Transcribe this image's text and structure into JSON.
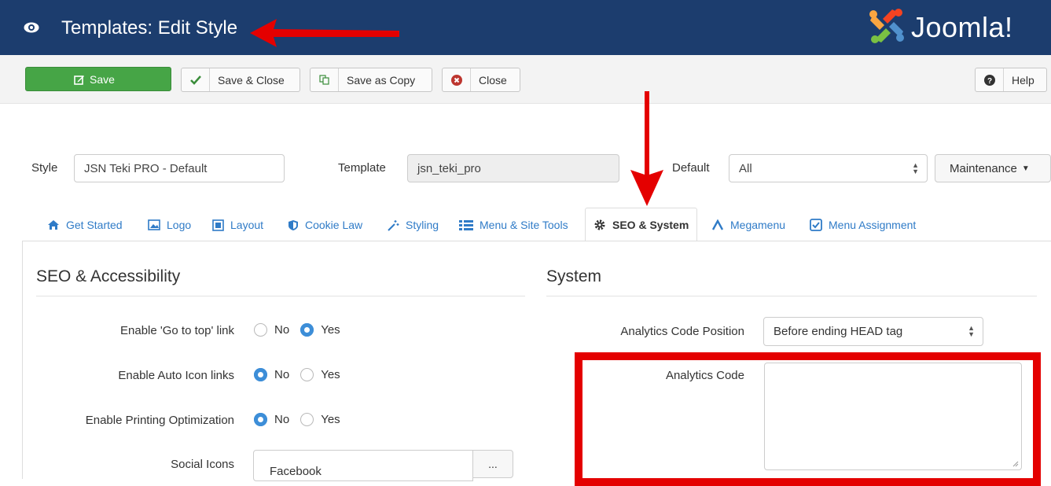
{
  "header": {
    "title": "Templates: Edit Style",
    "brand": "Joomla!",
    "colors": {
      "bar": "#1c3d6e"
    }
  },
  "toolbar": {
    "save": "Save",
    "save_close": "Save & Close",
    "save_copy": "Save as Copy",
    "close": "Close",
    "help": "Help",
    "colors": {
      "save": "#46a546"
    }
  },
  "form": {
    "style_label": "Style",
    "style_value": "JSN Teki PRO - Default",
    "template_label": "Template",
    "template_value": "jsn_teki_pro",
    "default_label": "Default",
    "default_value": "All",
    "maintenance": "Maintenance"
  },
  "tabs": [
    {
      "label": "Get Started",
      "icon": "home-icon"
    },
    {
      "label": "Logo",
      "icon": "image-icon"
    },
    {
      "label": "Layout",
      "icon": "square-icon"
    },
    {
      "label": "Cookie Law",
      "icon": "shield-icon"
    },
    {
      "label": "Styling",
      "icon": "wand-icon"
    },
    {
      "label": "Menu & Site Tools",
      "icon": "list-icon"
    },
    {
      "label": "SEO & System",
      "icon": "gear-icon",
      "active": true
    },
    {
      "label": "Megamenu",
      "icon": "caret-icon"
    },
    {
      "label": "Menu Assignment",
      "icon": "checkbox-icon"
    }
  ],
  "seo": {
    "title": "SEO & Accessibility",
    "rows": [
      {
        "label": "Enable 'Go to top' link",
        "no": "No",
        "yes": "Yes",
        "selected": "Yes"
      },
      {
        "label": "Enable Auto Icon links",
        "no": "No",
        "yes": "Yes",
        "selected": "No"
      },
      {
        "label": "Enable Printing Optimization",
        "no": "No",
        "yes": "Yes",
        "selected": "No"
      }
    ],
    "social_label": "Social Icons",
    "social_value": "Facebook",
    "social_button": "..."
  },
  "system": {
    "title": "System",
    "position_label": "Analytics Code Position",
    "position_value": "Before ending HEAD tag",
    "code_label": "Analytics Code",
    "code_value": ""
  },
  "annotations": {
    "color": "#e40000"
  }
}
